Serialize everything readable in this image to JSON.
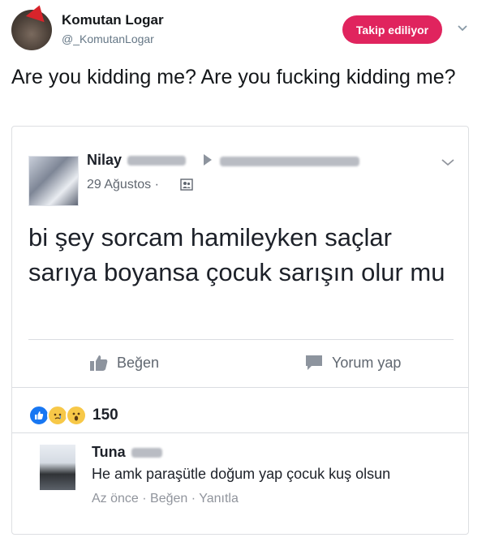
{
  "tweet": {
    "display_name": "Komutan Logar",
    "handle": "@_KomutanLogar",
    "follow_label": "Takip ediliyor",
    "text": "Are you kidding me? Are you fucking kidding me?"
  },
  "fb_post": {
    "author_first": "Nilay",
    "date": "29 Ağustos",
    "separator": "·",
    "text": "bi şey sorcam hamileyken saçlar sarıya boyansa çocuk sarışın olur mu",
    "like_label": "Beğen",
    "comment_label": "Yorum yap",
    "reaction_count": "150",
    "comment": {
      "author_first": "Tuna",
      "text": "He amk paraşütle doğum yap çocuk kuş olsun",
      "time": "Az önce",
      "like": "Beğen",
      "reply": "Yanıtla",
      "sep": "·"
    }
  },
  "icons": {
    "like": "thumbs-up-icon",
    "comment": "comment-bubble-icon",
    "audience": "friends-icon",
    "chevron": "chevron-down-icon"
  },
  "colors": {
    "follow_button": "#e0245e",
    "fb_like_reaction": "#1877f2",
    "fb_emoji": "#f7c848"
  }
}
